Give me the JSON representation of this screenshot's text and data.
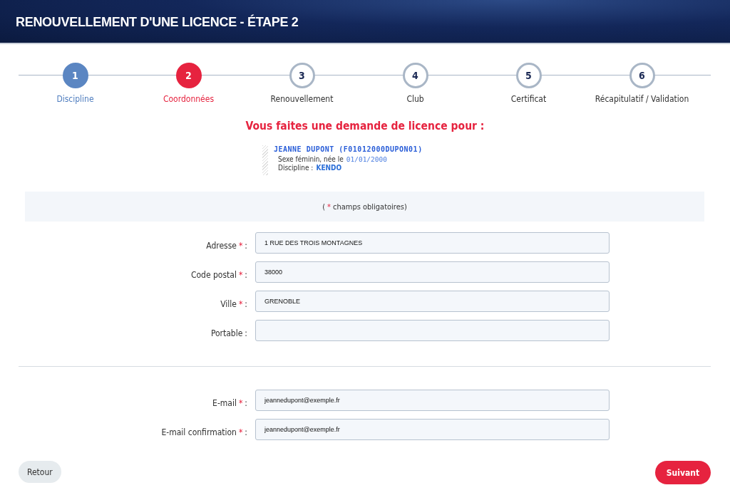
{
  "header": {
    "title": "RENOUVELLEMENT D'UNE LICENCE - ÉTAPE 2"
  },
  "steps": [
    {
      "number": "1",
      "label": "Discipline",
      "kind": "done"
    },
    {
      "number": "2",
      "label": "Coordonnées",
      "kind": "current"
    },
    {
      "number": "3",
      "label": "Renouvellement",
      "kind": "todo"
    },
    {
      "number": "4",
      "label": "Club",
      "kind": "todo"
    },
    {
      "number": "5",
      "label": "Certificat",
      "kind": "todo"
    },
    {
      "number": "6",
      "label": "Récapitulatif / Validation",
      "kind": "todo"
    }
  ],
  "request": {
    "heading": "Vous faites une demande de licence pour :",
    "name": "JEANNE DUPONT (F01012000DUPON01)",
    "sex_text": "Sexe féminin, née le",
    "birth_date": "01/01/2000",
    "discipline_label": "Discipline :",
    "discipline": "KENDO"
  },
  "note": {
    "open": "(",
    "mark": "*",
    "text": "champs obligatoires)"
  },
  "address_fields": [
    {
      "label": "Adresse",
      "required_mark": "*",
      "suffix": ":",
      "value": "1 RUE DES TROIS MONTAGNES"
    },
    {
      "label": "Code postal",
      "required_mark": "*",
      "suffix": ":",
      "value": "38000"
    },
    {
      "label": "Ville",
      "required_mark": "*",
      "suffix": ":",
      "value": "GRENOBLE"
    },
    {
      "label": "Portable",
      "suffix": ":"
    }
  ],
  "email_fields": [
    {
      "label": "E-mail",
      "required_mark": "*",
      "suffix": ":",
      "value": "jeannedupont@exemple.fr"
    },
    {
      "label": "E-mail confirmation",
      "required_mark": "*",
      "suffix": ":",
      "value": "jeannedupont@exemple.fr"
    }
  ],
  "buttons": {
    "back": "Retour",
    "next": "Suivant"
  }
}
